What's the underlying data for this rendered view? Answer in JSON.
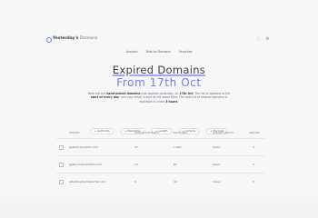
{
  "brand": {
    "name": "Yesterday's",
    "suffix": "Domains"
  },
  "header_icons": [
    "profile-icon",
    "settings-icon"
  ],
  "nav": [
    "Analysis",
    "Bids for Domains",
    "Favorites"
  ],
  "hero": {
    "title": "Expired Domains",
    "subtitle": "From 17th Oct",
    "description_parts": [
      "Here are the ",
      "hand-picked domains",
      " that expired yesterday, on ",
      "17th Oct",
      ". The list is updated at the ",
      "start of every day",
      ", and your email is sent at the same time. The next list of expired domains is available in under ",
      "5 hours",
      "."
    ]
  },
  "filters": [
    "Authority",
    "Backlinks",
    "Length",
    "Include",
    "Exclude"
  ],
  "table": {
    "columns": [
      "Domain",
      "Domain Authority",
      "Backlinks",
      "Domain Length",
      "Analyse"
    ],
    "rows": [
      {
        "domain": "galacticsmartful.com",
        "authority": "17",
        "backlinks": "1,904",
        "length": "Clean"
      },
      {
        "domain": "gettyoursmarthello.com",
        "authority": "13",
        "backlinks": "82",
        "length": "Clean"
      },
      {
        "domain": "sktestingthethepartial.com",
        "authority": "5",
        "backlinks": "16",
        "length": "Clean"
      }
    ]
  }
}
